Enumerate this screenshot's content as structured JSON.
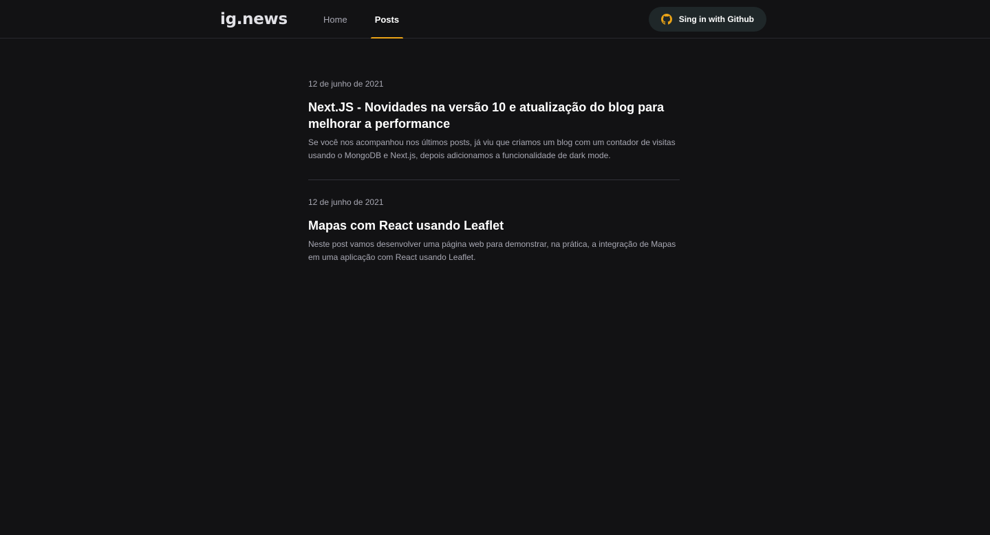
{
  "header": {
    "logo": "ig.news",
    "nav": {
      "home_label": "Home",
      "posts_label": "Posts"
    },
    "signin_label": "Sing in with Github",
    "accent_color": "#eba417"
  },
  "posts": [
    {
      "date": "12 de junho de 2021",
      "title": "Next.JS - Novidades na versão 10 e atualização do blog para melhorar a performance",
      "excerpt": "Se você nos acompanhou nos últimos posts, já viu que criamos um blog com um contador de visitas usando o MongoDB e Next.js, depois adicionamos a funcionalidade de dark mode."
    },
    {
      "date": "12 de junho de 2021",
      "title": "Mapas com React usando Leaflet",
      "excerpt": "Neste post vamos desenvolver uma página web para demonstrar, na prática, a integração de Mapas em uma aplicação com React usando Leaflet."
    }
  ]
}
